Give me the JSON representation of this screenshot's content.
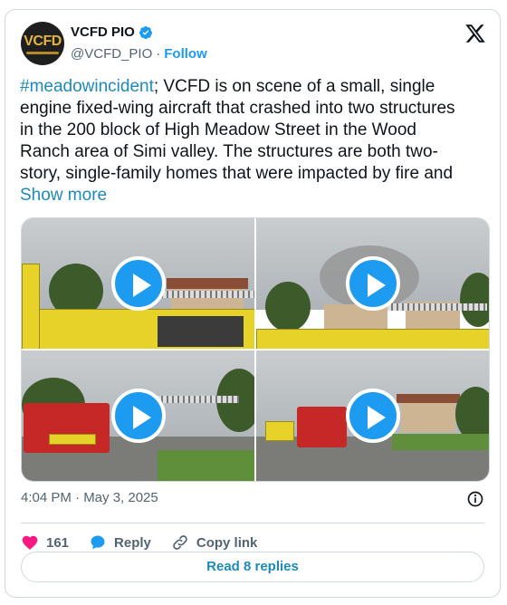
{
  "author": {
    "display_name": "VCFD PIO",
    "handle": "@VCFD_PIO",
    "separator": "·",
    "follow_label": "Follow",
    "avatar_text": "VCFD"
  },
  "tweet": {
    "hashtag": "#meadowincident",
    "body": "; VCFD is on scene of a small, single engine fixed-wing aircraft that crashed into two structures in the 200 block of High Meadow Street in the Wood Ranch area of Simi valley. The structures are both two-story, single-family homes that were  impacted by fire and ",
    "show_more": "Show more"
  },
  "media": {
    "videos": [
      {
        "icon": "play-icon"
      },
      {
        "icon": "play-icon"
      },
      {
        "icon": "play-icon"
      },
      {
        "icon": "play-icon"
      }
    ]
  },
  "meta": {
    "timestamp": "4:04 PM · May 3, 2025"
  },
  "actions": {
    "like_count": "161",
    "reply_label": "Reply",
    "copy_link_label": "Copy link"
  },
  "footer": {
    "read_replies_label": "Read 8 replies"
  },
  "colors": {
    "accent": "#1d9bf0",
    "link": "#1d8ab8",
    "like": "#f91880",
    "muted": "#536471",
    "border": "#cfd9de"
  }
}
